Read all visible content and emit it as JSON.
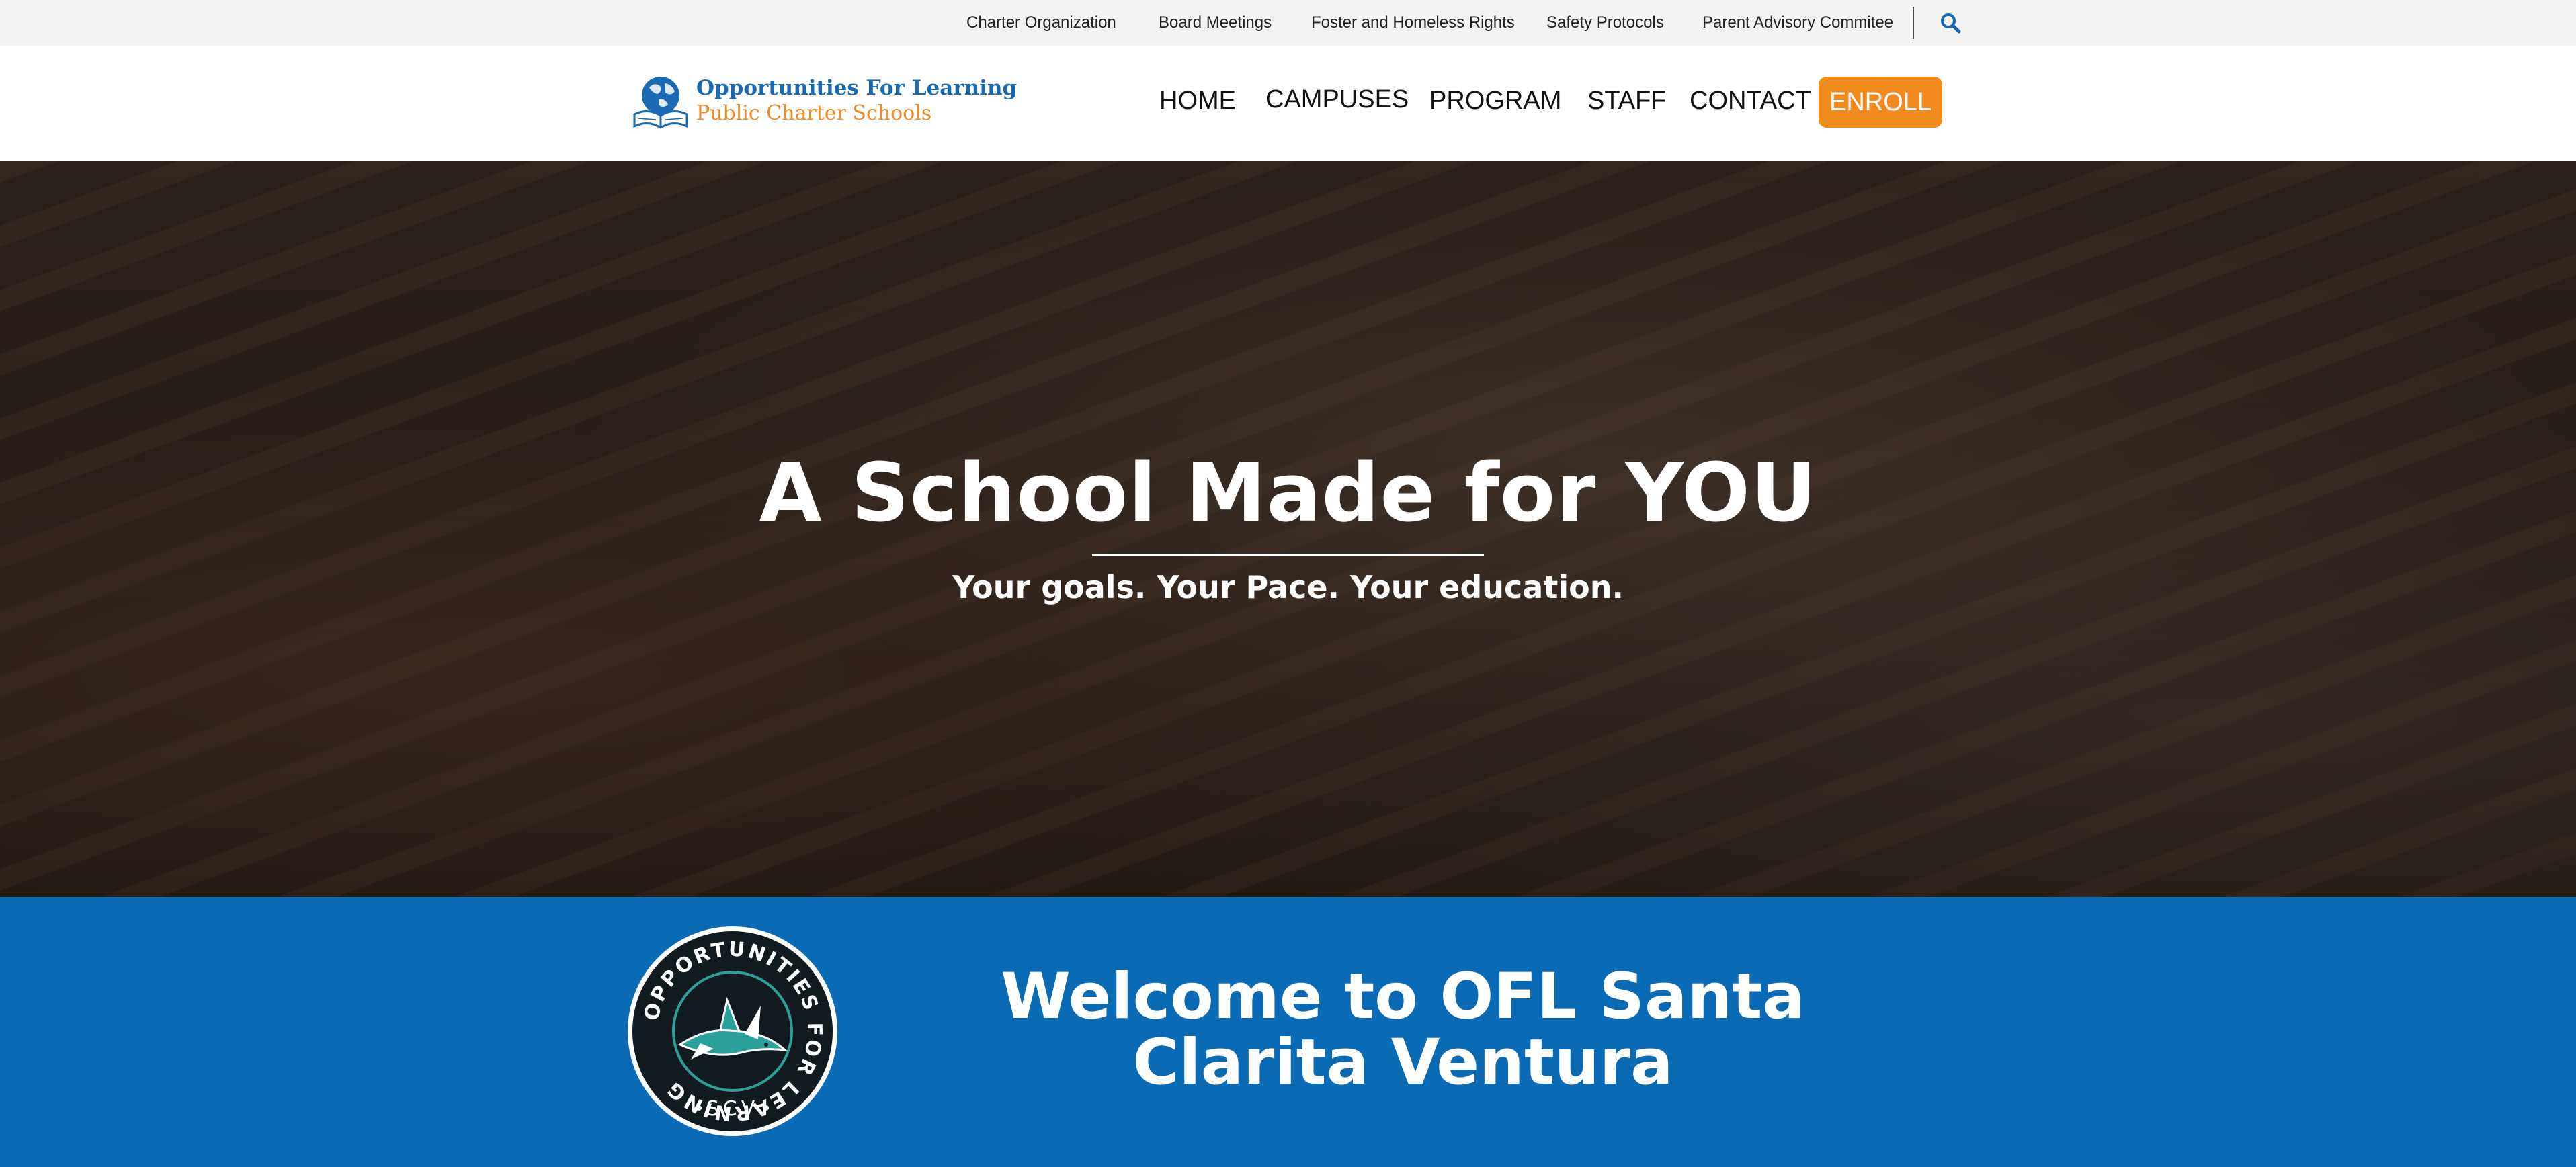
{
  "utility_nav": {
    "items": [
      "Charter Organization",
      "Board Meetings",
      "Foster and Homeless Rights",
      "Safety Protocols",
      "Parent Advisory Commitee"
    ],
    "search_icon": "search-icon"
  },
  "logo": {
    "line1": "Opportunities For Learning",
    "line2": "Public Charter Schools",
    "icon": "globe-book-icon"
  },
  "main_nav": {
    "items": [
      "HOME",
      "CAMPUSES",
      "PROGRAM",
      "STAFF",
      "CONTACT"
    ],
    "enroll_label": "ENROLL"
  },
  "hero": {
    "title": "A School Made for YOU",
    "subtitle": "Your goals. Your Pace. Your education."
  },
  "welcome": {
    "title": "Welcome to OFL Santa Clarita Ventura",
    "badge": {
      "ring_text": "OPPORTUNITIES FOR LEARNING",
      "code": "SCV",
      "icon": "shark-icon"
    }
  },
  "colors": {
    "brand_blue": "#0a6ab4",
    "logo_blue": "#1a6ab3",
    "accent_orange": "#f28a1e",
    "utility_bg": "#f3f3f3",
    "badge_teal": "#2aa198"
  }
}
